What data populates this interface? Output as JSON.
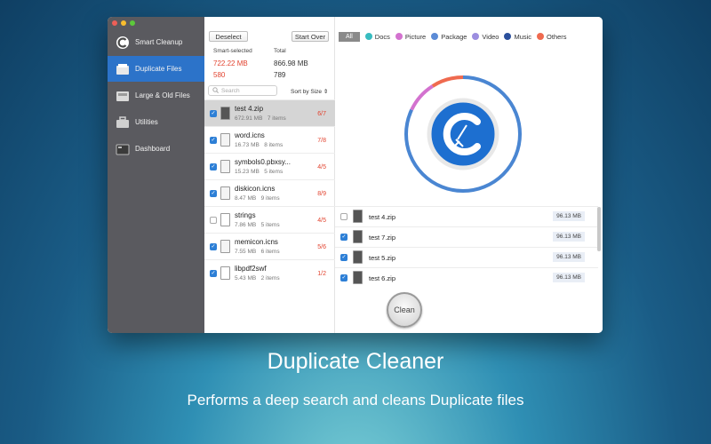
{
  "window": {
    "traffic_colors": [
      "#ee5f57",
      "#f8bd2e",
      "#5cc93b"
    ]
  },
  "sidebar": {
    "items": [
      {
        "label": "Smart Cleanup",
        "icon": "cleaner-logo-icon",
        "active": false
      },
      {
        "label": "Duplicate Files",
        "icon": "duplicate-files-icon",
        "active": true
      },
      {
        "label": "Large & Old Files",
        "icon": "large-files-icon",
        "active": false
      },
      {
        "label": "Utilities",
        "icon": "utilities-toolbox-icon",
        "active": false
      },
      {
        "label": "Dashboard",
        "icon": "dashboard-icon",
        "active": false
      }
    ]
  },
  "list": {
    "deselect_label": "Deselect",
    "start_over_label": "Start Over",
    "smart_selected_label": "Smart-selected",
    "total_label": "Total",
    "smart_selected_size": "722.22 MB",
    "smart_selected_count": "580",
    "total_size": "866.98 MB",
    "total_count": "789",
    "search_placeholder": "Search",
    "sort_label": "Sort by Size",
    "files": [
      {
        "name": "test 4.zip",
        "size": "672.91 MB",
        "items": "7 items",
        "count": "6/7",
        "checked": true,
        "selected": true
      },
      {
        "name": "word.icns",
        "size": "16.73 MB",
        "items": "8 items",
        "count": "7/8",
        "checked": true,
        "selected": false
      },
      {
        "name": "symbols0.pbxsy...",
        "size": "15.23 MB",
        "items": "5 items",
        "count": "4/5",
        "checked": true,
        "selected": false
      },
      {
        "name": "diskicon.icns",
        "size": "8.47 MB",
        "items": "9 items",
        "count": "8/9",
        "checked": true,
        "selected": false
      },
      {
        "name": "strings",
        "size": "7.86 MB",
        "items": "5 items",
        "count": "4/5",
        "checked": false,
        "selected": false
      },
      {
        "name": "memicon.icns",
        "size": "7.55 MB",
        "items": "6 items",
        "count": "5/6",
        "checked": true,
        "selected": false
      },
      {
        "name": "libpdf2swf",
        "size": "5.43 MB",
        "items": "2 items",
        "count": "1/2",
        "checked": true,
        "selected": false
      }
    ]
  },
  "filters": {
    "all_label": "All",
    "items": [
      {
        "label": "Docs",
        "color": "#38bcc0"
      },
      {
        "label": "Picture",
        "color": "#d372cf"
      },
      {
        "label": "Package",
        "color": "#5b8bd6"
      },
      {
        "label": "Video",
        "color": "#9c8ee0"
      },
      {
        "label": "Music",
        "color": "#2a4f9c"
      },
      {
        "label": "Others",
        "color": "#ef6a4f"
      }
    ]
  },
  "ring": {
    "segments": [
      {
        "color": "#4a86d2",
        "fraction": 0.82
      },
      {
        "color": "#d372cf",
        "fraction": 0.09
      },
      {
        "color": "#ef6a4f",
        "fraction": 0.09
      }
    ]
  },
  "duplicates": [
    {
      "name": "test 4.zip",
      "size": "96.13 MB",
      "checked": false
    },
    {
      "name": "test 7.zip",
      "size": "96.13 MB",
      "checked": true
    },
    {
      "name": "test 5.zip",
      "size": "96.13 MB",
      "checked": true
    },
    {
      "name": "test 6.zip",
      "size": "96.13 MB",
      "checked": true
    }
  ],
  "clean_label": "Clean",
  "headline": "Duplicate Cleaner",
  "subheadline": "Performs a deep search and cleans Duplicate files"
}
